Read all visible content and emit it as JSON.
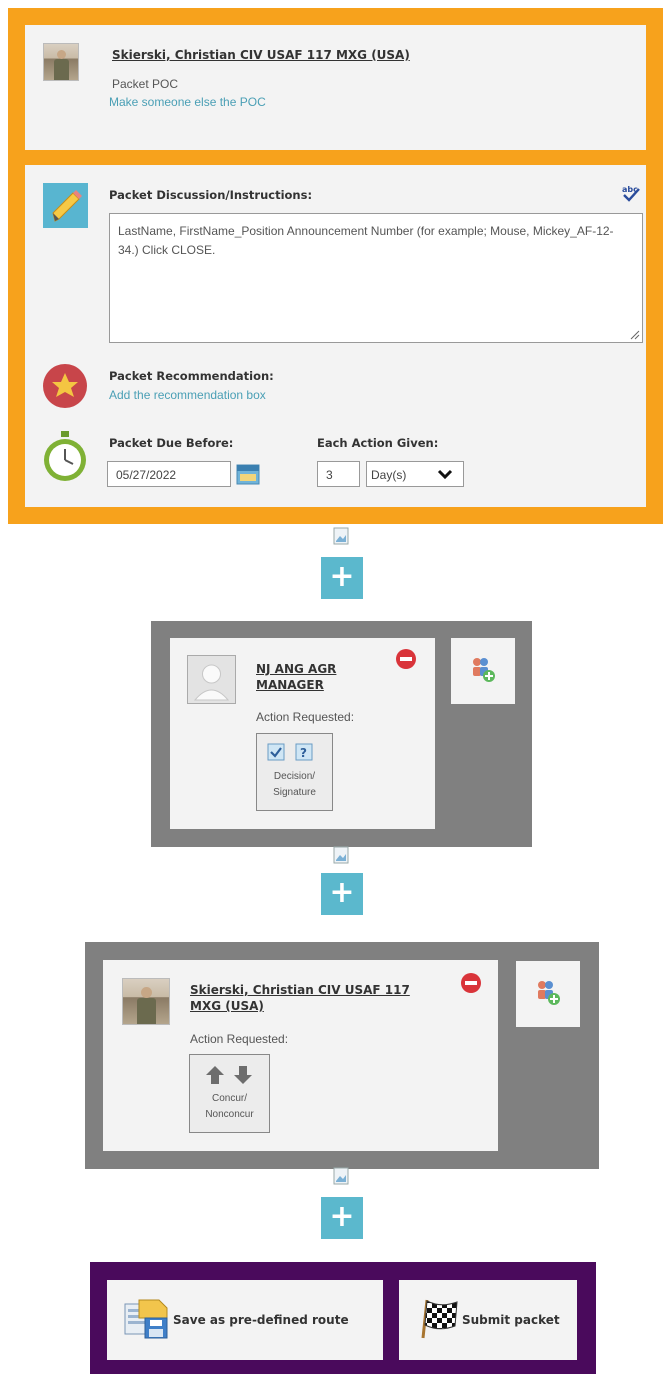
{
  "packet_poc": {
    "name": "Skierski, Christian CIV USAF 117 MXG (USA)",
    "role": "Packet POC",
    "change_link": "Make someone else the POC"
  },
  "discussion": {
    "label": "Packet Discussion/Instructions:",
    "text": "LastName, FirstName_Position Announcement Number (for example; Mouse, Mickey_AF-12-34.) Click CLOSE."
  },
  "recommendation": {
    "label": "Packet Recommendation:",
    "add_link": "Add the recommendation box"
  },
  "due": {
    "label": "Packet Due Before:",
    "date": "05/27/2022",
    "each_action_label": "Each Action Given:",
    "each_action_value": "3",
    "unit": "Day(s)"
  },
  "steps": [
    {
      "name": "NJ ANG AGR MANAGER",
      "action_label": "Action Requested:",
      "action": "Decision/ Signature"
    },
    {
      "name": "Skierski, Christian CIV USAF 117 MXG (USA)",
      "action_label": "Action Requested:",
      "action": "Concur/ Nonconcur"
    }
  ],
  "add_step_symbol": "+",
  "buttons": {
    "save_route": "Save as pre-defined route",
    "submit": "Submit packet"
  },
  "colors": {
    "packet_frame": "#f7a21c",
    "step_frame": "#808080",
    "action_frame": "#4a0a5c",
    "add_button": "#5bb8cd",
    "link": "#4a9fb5"
  }
}
